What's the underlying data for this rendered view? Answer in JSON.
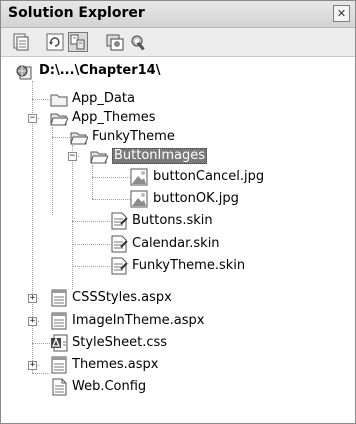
{
  "panel": {
    "title": "Solution Explorer",
    "close_glyph": "✕"
  },
  "toolbar": {
    "buttons": [
      {
        "icon": "properties-icon"
      },
      {
        "icon": "refresh-icon"
      },
      {
        "icon": "nest-related-files-icon",
        "active": true
      },
      {
        "icon": "copy-website-icon"
      },
      {
        "icon": "asp-net-configuration-icon"
      }
    ]
  },
  "tree": {
    "root": "D:\\...\\Chapter14\\",
    "app_data": "App_Data",
    "app_themes": "App_Themes",
    "funky_theme": "FunkyTheme",
    "button_images": "ButtonImages",
    "button_cancel": "buttonCancel.jpg",
    "button_ok": "buttonOK.jpg",
    "buttons_skin": "Buttons.skin",
    "calendar_skin": "Calendar.skin",
    "funky_theme_skin": "FunkyTheme.skin",
    "css_styles": "CSSStyles.aspx",
    "image_in_theme": "ImageInTheme.aspx",
    "stylesheet": "StyleSheet.css",
    "themes_aspx": "Themes.aspx",
    "web_config": "Web.Config"
  },
  "glyphs": {
    "expand": "+",
    "collapse": "−"
  },
  "colors": {
    "selection": "#7a7a7a",
    "titlebar": "#dcdcdc"
  }
}
